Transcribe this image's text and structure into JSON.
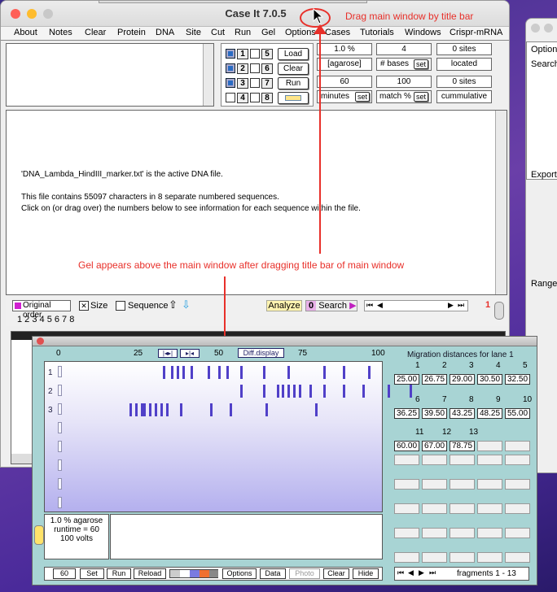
{
  "title": "Case It 7.0.5",
  "menu": [
    "About",
    "Notes",
    "Clear",
    "Protein",
    "DNA",
    "Site",
    "Cut",
    "Run",
    "Gel",
    "Options",
    "Cases",
    "Tutorials",
    "Windows",
    "Crispr-mRNA"
  ],
  "controls": {
    "lane_nums": [
      "1",
      "5",
      "2",
      "6",
      "3",
      "7",
      "4",
      "8"
    ],
    "load": "Load",
    "clear": "Clear",
    "run": "Run",
    "agarose_val": "1.0 %",
    "agarose_lbl": "[agarose]",
    "minutes_val": "60",
    "minutes_lbl": "minutes",
    "set": "set",
    "bases_val": "4",
    "bases_lbl": "# bases",
    "match_val": "100",
    "match_lbl": "match %",
    "sites1": "0 sites",
    "located": "located",
    "sites2": "0 sites",
    "cumulative": "cummulative"
  },
  "main_text": {
    "line1": "'DNA_Lambda_HindIII_marker.txt' is the active DNA file.",
    "line2": "This file contains 55097 characters in 8 separate numbered sequences.",
    "line3": "Click on (or drag over) the numbers below to see information for each sequence within the file."
  },
  "bottom": {
    "original_order": "Original order",
    "size": "Size",
    "sequence": "Sequence",
    "analyze": "Analyze",
    "search_num": "0",
    "search": "Search",
    "page_num": "1",
    "seq_nums": "1 2 3 4 5 6 7 8"
  },
  "side_window": {
    "options": "Option",
    "search": "Search",
    "export": "Export",
    "range": "Range"
  },
  "annotations": {
    "drag": "Drag main window by title bar",
    "gel_note": "Gel appears above the main window after dragging title bar of main window"
  },
  "gel": {
    "scale": [
      "0",
      "25",
      "50",
      "75",
      "100"
    ],
    "diff_display": "Diff.display",
    "lanes": [
      "1",
      "2",
      "3"
    ],
    "agarose": "1.0 % agarose",
    "runtime": "runtime = 60",
    "volts": "100 volts",
    "migration_title": "Migration distances for lane 1",
    "col_nums": [
      "1",
      "2",
      "3",
      "4",
      "5",
      "6",
      "7",
      "8",
      "9",
      "10",
      "11",
      "12",
      "13"
    ],
    "distances": [
      "25.00",
      "26.75",
      "29.00",
      "30.50",
      "32.50",
      "36.25",
      "39.50",
      "43.25",
      "48.25",
      "55.00",
      "60.00",
      "67.00",
      "78.75"
    ],
    "buttons": {
      "runtime": "60",
      "set": "Set",
      "run": "Run",
      "reload": "Reload",
      "options": "Options",
      "data": "Data",
      "photo": "Photo",
      "clear": "Clear",
      "hide": "Hide"
    },
    "fragments": "fragments 1 - 13",
    "lane_bands": {
      "1": [
        38,
        41,
        43,
        45,
        48,
        54,
        58,
        61,
        66,
        74,
        83,
        96,
        103,
        112
      ],
      "2": [
        66,
        74,
        79,
        81,
        83,
        85,
        87,
        91,
        96,
        103,
        110,
        119,
        127
      ],
      "3": [
        26,
        28,
        30,
        31,
        33,
        35,
        37,
        39,
        44,
        55,
        62,
        75,
        93
      ]
    }
  },
  "colors": {
    "accent_red": "#e8302a",
    "band": "#5040c8",
    "gel_bg": "#a8d4d4"
  }
}
